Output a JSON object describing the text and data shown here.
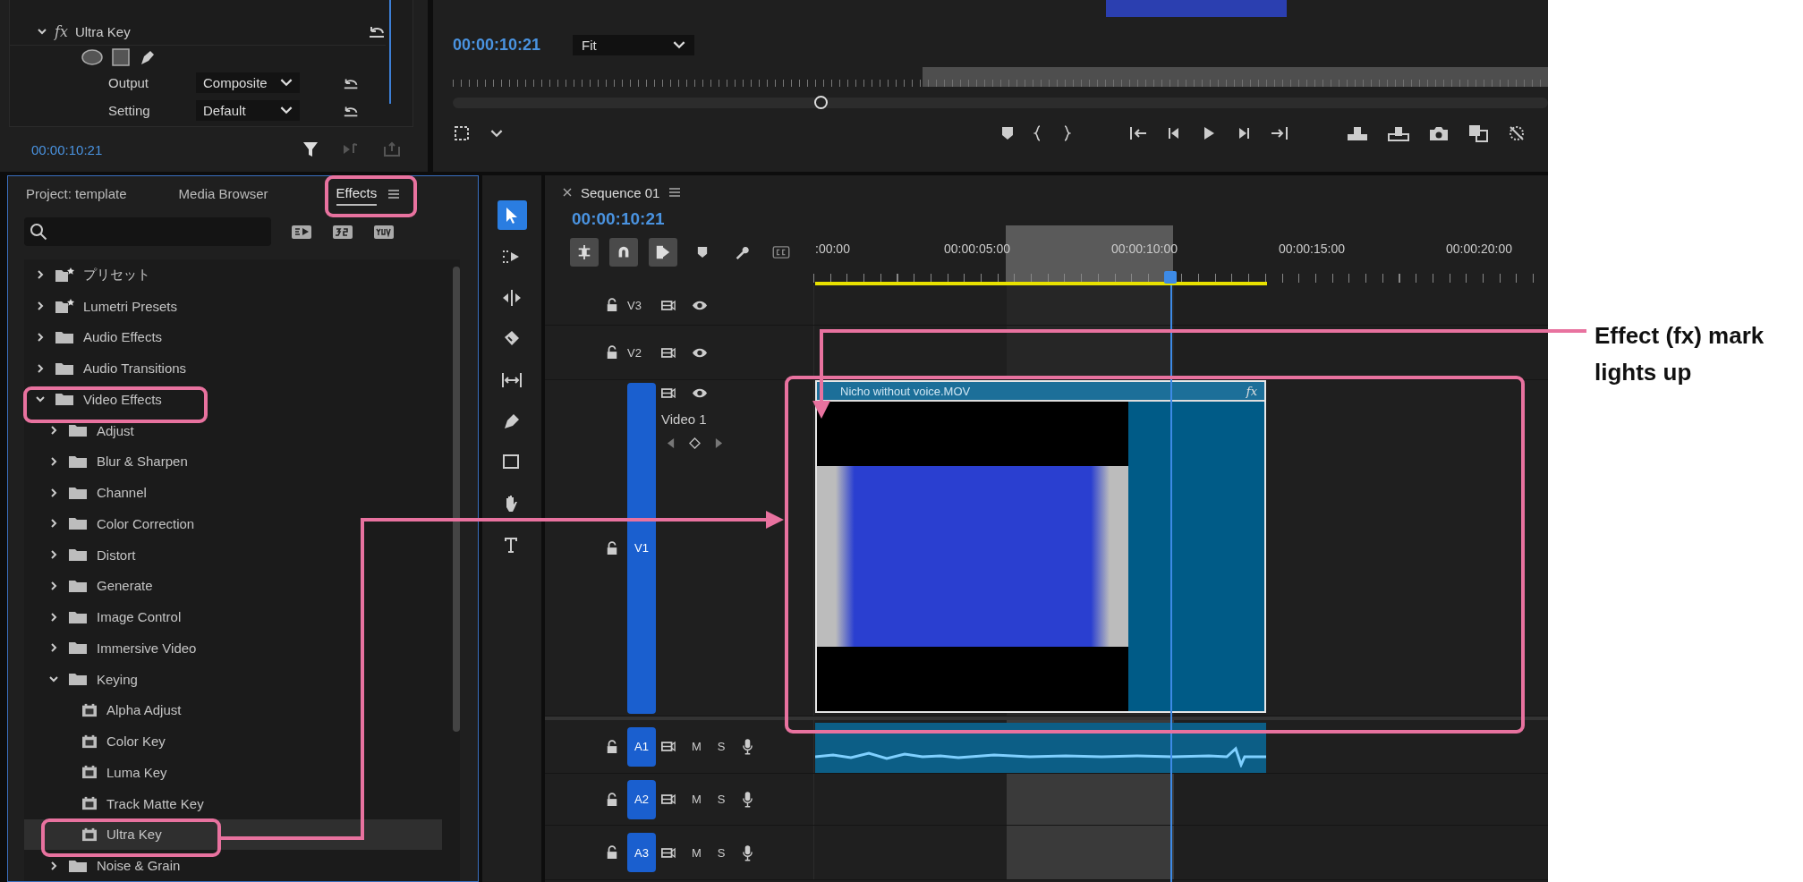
{
  "effect_controls": {
    "effect": {
      "badge": "fx",
      "name": "Ultra Key",
      "expanded": true
    },
    "properties": [
      {
        "label": "Output",
        "value": "Composite"
      },
      {
        "label": "Setting",
        "value": "Default"
      }
    ],
    "timecode": "00:00:10:21"
  },
  "program_monitor": {
    "timecode": "00:00:10:21",
    "zoom": "Fit"
  },
  "effects_panel": {
    "tabs": [
      {
        "label": "Project: template",
        "selected": false
      },
      {
        "label": "Media Browser",
        "selected": false
      },
      {
        "label": "Effects",
        "selected": true
      }
    ],
    "tree": [
      {
        "label": "プリセット",
        "kind": "preset-folder",
        "expanded": false,
        "selected": false
      },
      {
        "label": "Lumetri Presets",
        "kind": "preset-folder",
        "expanded": false,
        "selected": false
      },
      {
        "label": "Audio Effects",
        "kind": "folder",
        "expanded": false,
        "selected": false
      },
      {
        "label": "Audio Transitions",
        "kind": "folder",
        "expanded": false,
        "selected": false
      },
      {
        "label": "Video Effects",
        "kind": "folder",
        "expanded": true,
        "selected": false,
        "children": [
          {
            "label": "Adjust",
            "kind": "folder",
            "expanded": false,
            "selected": false
          },
          {
            "label": "Blur & Sharpen",
            "kind": "folder",
            "expanded": false,
            "selected": false
          },
          {
            "label": "Channel",
            "kind": "folder",
            "expanded": false,
            "selected": false
          },
          {
            "label": "Color Correction",
            "kind": "folder",
            "expanded": false,
            "selected": false
          },
          {
            "label": "Distort",
            "kind": "folder",
            "expanded": false,
            "selected": false
          },
          {
            "label": "Generate",
            "kind": "folder",
            "expanded": false,
            "selected": false
          },
          {
            "label": "Image Control",
            "kind": "folder",
            "expanded": false,
            "selected": false
          },
          {
            "label": "Immersive Video",
            "kind": "folder",
            "expanded": false,
            "selected": false
          },
          {
            "label": "Keying",
            "kind": "folder",
            "expanded": true,
            "selected": false,
            "children": [
              {
                "label": "Alpha Adjust",
                "kind": "effect",
                "selected": false
              },
              {
                "label": "Color Key",
                "kind": "effect",
                "selected": false
              },
              {
                "label": "Luma Key",
                "kind": "effect",
                "selected": false
              },
              {
                "label": "Track Matte Key",
                "kind": "effect",
                "selected": false
              },
              {
                "label": "Ultra Key",
                "kind": "effect",
                "selected": true
              }
            ]
          },
          {
            "label": "Noise & Grain",
            "kind": "folder",
            "expanded": false,
            "selected": false
          }
        ]
      }
    ]
  },
  "tools": [
    {
      "kind": "selection",
      "selected": true
    },
    {
      "kind": "track-select",
      "selected": false
    },
    {
      "kind": "ripple",
      "selected": false
    },
    {
      "kind": "razor",
      "selected": false
    },
    {
      "kind": "slip",
      "selected": false
    },
    {
      "kind": "pen",
      "selected": false
    },
    {
      "kind": "rectangle",
      "selected": false
    },
    {
      "kind": "hand",
      "selected": false
    },
    {
      "kind": "type",
      "selected": false
    }
  ],
  "timeline": {
    "sequence": "Sequence 01",
    "timecode": "00:00:10:21",
    "toolbar": [
      {
        "kind": "nest",
        "on": true
      },
      {
        "kind": "snap",
        "on": true
      },
      {
        "kind": "linked",
        "on": true
      },
      {
        "kind": "marker",
        "on": false
      },
      {
        "kind": "wrench",
        "on": false
      },
      {
        "kind": "captions",
        "on": false
      }
    ],
    "ruler": [
      ":00:00",
      "00:00:05:00",
      "00:00:10:00",
      "00:00:15:00",
      "00:00:20:00"
    ],
    "tracks": [
      {
        "name": "V3",
        "kind": "video",
        "targeted": false
      },
      {
        "name": "V2",
        "kind": "video",
        "targeted": false
      },
      {
        "name": "V1",
        "kind": "video",
        "targeted": true,
        "title": "Video 1"
      },
      {
        "name": "A1",
        "kind": "audio",
        "targeted": true,
        "mute": "M",
        "solo": "S"
      },
      {
        "name": "A2",
        "kind": "audio",
        "targeted": true,
        "mute": "M",
        "solo": "S"
      },
      {
        "name": "A3",
        "kind": "audio",
        "targeted": true,
        "mute": "M",
        "solo": "S"
      }
    ],
    "clip": {
      "name": "Nicho without voice.MOV",
      "fx_badge": "fx"
    }
  },
  "annotation": {
    "text": "Effect (fx) mark lights up"
  }
}
